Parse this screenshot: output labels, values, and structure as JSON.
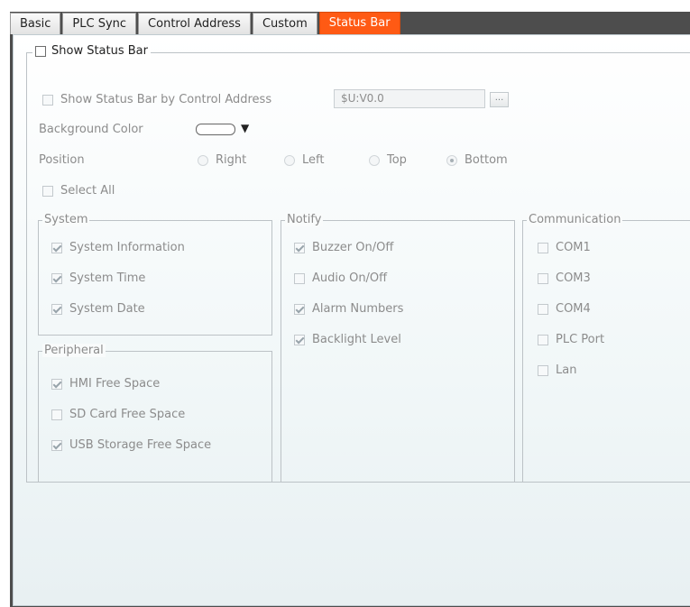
{
  "tabs": [
    {
      "label": "Basic",
      "active": false
    },
    {
      "label": "PLC Sync",
      "active": false
    },
    {
      "label": "Control Address",
      "active": false
    },
    {
      "label": "Custom",
      "active": false
    },
    {
      "label": "Status Bar",
      "active": true
    }
  ],
  "show_status_bar": {
    "label": "Show Status Bar",
    "checked": false
  },
  "by_control_address": {
    "label": "Show Status Bar by Control Address",
    "checked": false,
    "value": "$U:V0.0",
    "browse_label": "..."
  },
  "background_color": {
    "label": "Background Color",
    "value": "#ffffff"
  },
  "position": {
    "label": "Position",
    "options": [
      {
        "label": "Right",
        "selected": false
      },
      {
        "label": "Left",
        "selected": false
      },
      {
        "label": "Top",
        "selected": false
      },
      {
        "label": "Bottom",
        "selected": true
      }
    ]
  },
  "select_all": {
    "label": "Select All",
    "checked": false
  },
  "system": {
    "title": "System",
    "items": [
      {
        "label": "System Information",
        "checked": true
      },
      {
        "label": "System Time",
        "checked": true
      },
      {
        "label": "System Date",
        "checked": true
      }
    ]
  },
  "peripheral": {
    "title": "Peripheral",
    "items": [
      {
        "label": "HMI Free Space",
        "checked": true
      },
      {
        "label": "SD Card Free Space",
        "checked": false
      },
      {
        "label": "USB Storage Free Space",
        "checked": true
      }
    ]
  },
  "notify": {
    "title": "Notify",
    "items": [
      {
        "label": "Buzzer On/Off",
        "checked": true
      },
      {
        "label": "Audio On/Off",
        "checked": false
      },
      {
        "label": "Alarm Numbers",
        "checked": true
      },
      {
        "label": "Backlight Level",
        "checked": true
      }
    ]
  },
  "communication": {
    "title": "Communication",
    "items": [
      {
        "label": "COM1",
        "checked": false
      },
      {
        "label": "COM3",
        "checked": false
      },
      {
        "label": "COM4",
        "checked": false
      },
      {
        "label": "PLC Port",
        "checked": false
      },
      {
        "label": "Lan",
        "checked": false
      }
    ]
  },
  "colors": {
    "active_tab": "#ff5a14",
    "frame": "#4d4d4d"
  }
}
